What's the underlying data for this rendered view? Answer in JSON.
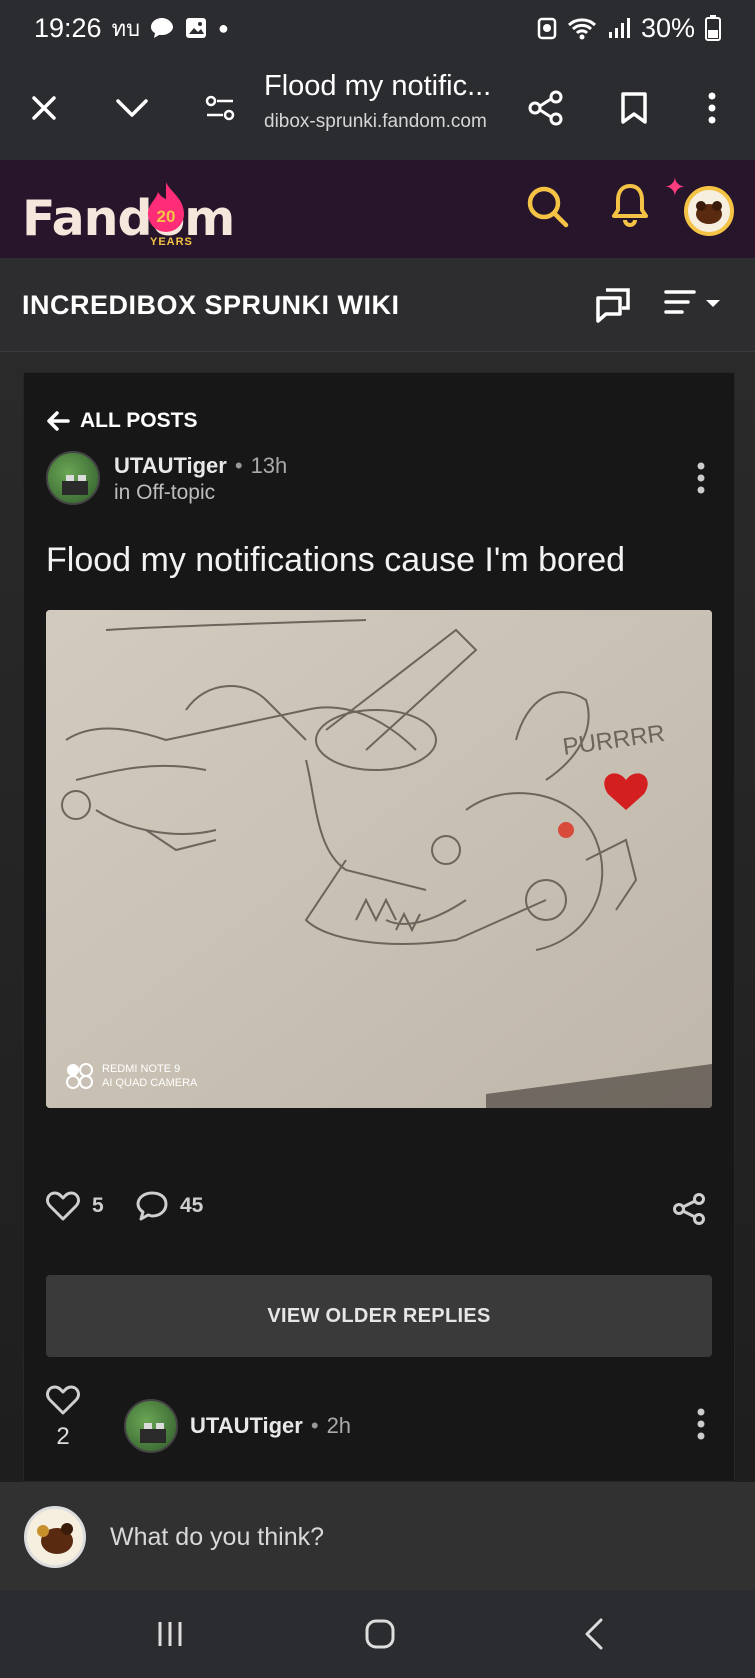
{
  "status_bar": {
    "time": "19:26",
    "carrier": "ทบ",
    "battery": "30%"
  },
  "browser": {
    "page_title": "Flood my notific...",
    "domain": "dibox-sprunki.fandom.com"
  },
  "fandom": {
    "logo_text": "Fandom",
    "badge": "20",
    "years": "YEARS"
  },
  "wiki": {
    "title": "INCREDIBOX SPRUNKI WIKI"
  },
  "post": {
    "back_label": "ALL POSTS",
    "author": "UTAUTiger",
    "time": "13h",
    "category": "in Off-topic",
    "title": "Flood my notifications cause I'm bored",
    "image": {
      "handwriting": "PURRRR",
      "camera_line1": "REDMI NOTE 9",
      "camera_line2": "AI QUAD CAMERA"
    },
    "likes": "5",
    "comments": "45",
    "view_older_label": "VIEW OLDER REPLIES"
  },
  "reply": {
    "likes": "2",
    "author": "UTAUTiger",
    "time": "2h"
  },
  "comment": {
    "placeholder": "What do you think?"
  },
  "colors": {
    "accent_yellow": "#f4c244",
    "accent_pink": "#ff3d7f",
    "fandom_bg": "#27152b",
    "card_bg": "#171717"
  }
}
